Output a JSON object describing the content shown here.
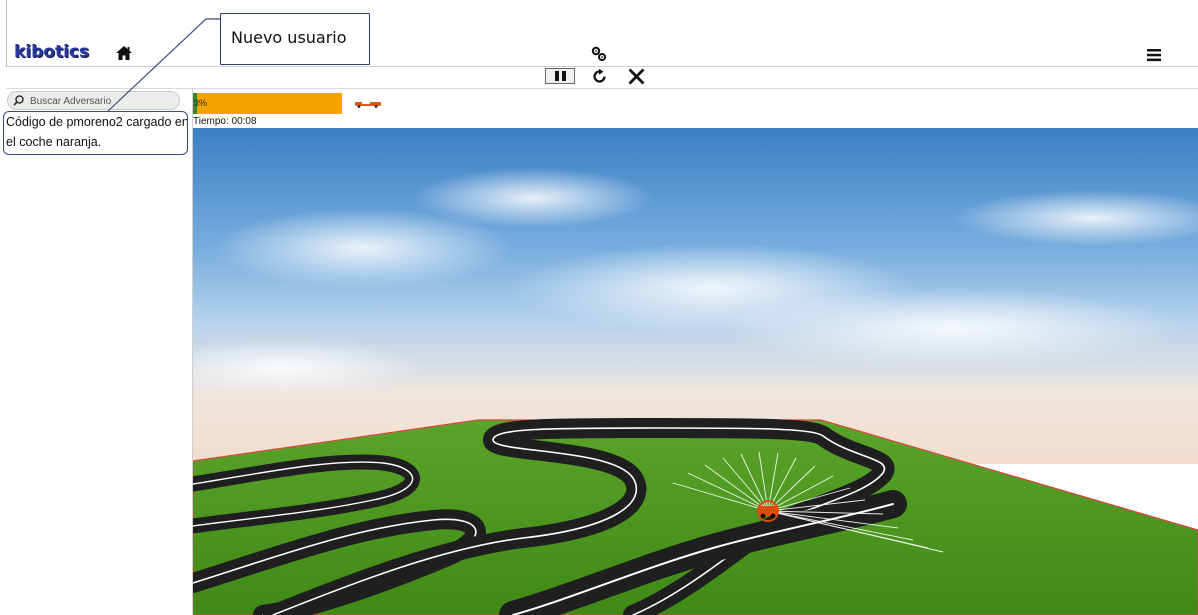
{
  "header": {
    "logo_text": "kibotics",
    "home_icon": "home-icon",
    "settings_icon": "gears-icon",
    "menu_icon": "hamburger-menu-icon"
  },
  "controls": {
    "pause_icon": "pause-icon",
    "reset_icon": "reset-icon",
    "close_icon": "close-icon"
  },
  "sidebar": {
    "search_placeholder": "Buscar Adversario",
    "message": "Código de pmoreno2 cargado en el coche naranja."
  },
  "race": {
    "progress_label": "3%",
    "progress_value": 0.03,
    "timer": "Tiempo: 00:08"
  },
  "annotation": {
    "callout_text": "Nuevo usuario"
  },
  "colors": {
    "progress_bar": "#f6a300",
    "progress_fill": "#2e8b2e",
    "callout_border": "#2c3d6b",
    "grass": "#4e9a1f",
    "sky": "#3f86cc",
    "track": "#1e1e1e",
    "car": "#e04a10"
  }
}
